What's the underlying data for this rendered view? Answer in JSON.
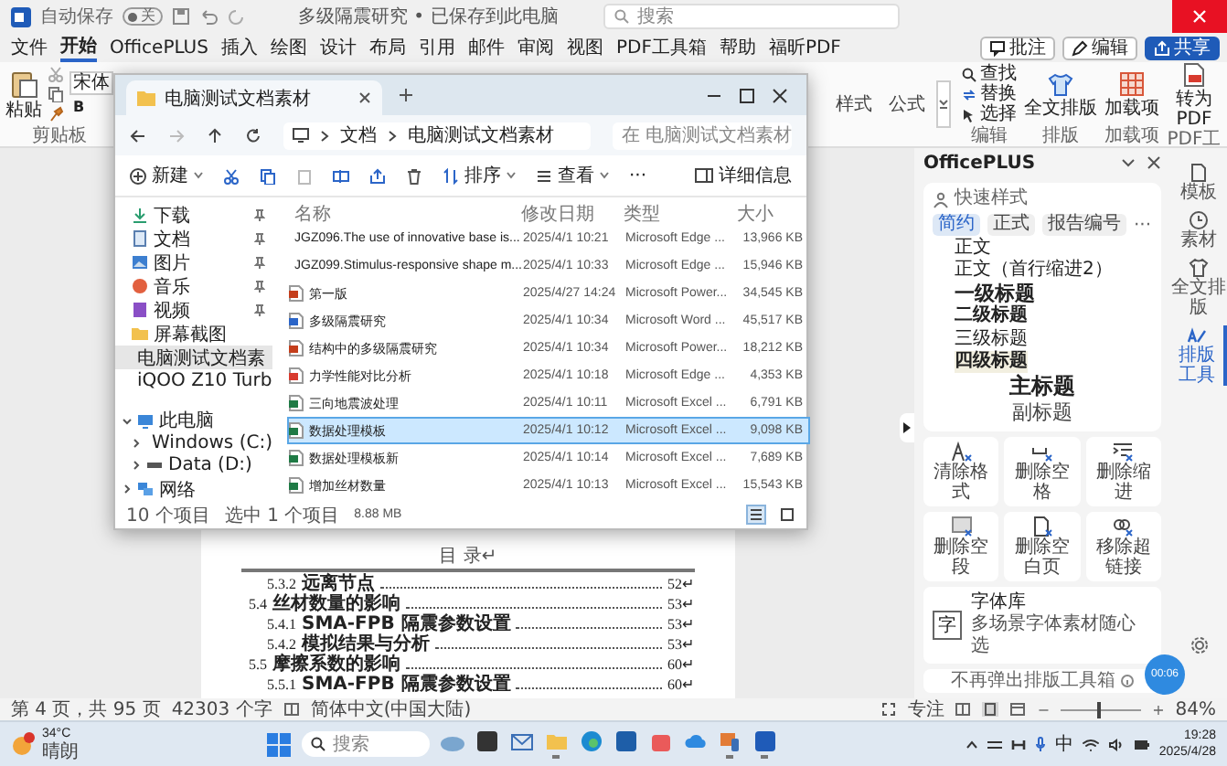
{
  "word_window": {
    "autosave_label": "自动保存",
    "autosave": {
      "on": false,
      "label": "关"
    },
    "title": "多级隔震研究 • 已保存到此电脑",
    "search_placeholder": "搜索"
  },
  "ribbon_tabs": [
    {
      "label": "文件",
      "selected": false
    },
    {
      "label": "开始",
      "selected": true
    },
    {
      "label": "OfficePLUS",
      "selected": false
    },
    {
      "label": "插入",
      "selected": false
    },
    {
      "label": "绘图",
      "selected": false
    },
    {
      "label": "设计",
      "selected": false
    },
    {
      "label": "布局",
      "selected": false
    },
    {
      "label": "引用",
      "selected": false
    },
    {
      "label": "邮件",
      "selected": false
    },
    {
      "label": "审阅",
      "selected": false
    },
    {
      "label": "视图",
      "selected": false
    },
    {
      "label": "PDF工具箱",
      "selected": false
    },
    {
      "label": "帮助",
      "selected": false
    },
    {
      "label": "福昕PDF",
      "selected": false
    }
  ],
  "ribbon_actions": [
    {
      "label": "批注",
      "kind": "comment"
    },
    {
      "label": "编辑",
      "kind": "edit"
    },
    {
      "label": "共享",
      "kind": "share"
    }
  ],
  "ribbon": {
    "paste": "粘贴",
    "clipboard_group": "剪贴板",
    "font": "宋体",
    "bold": "B",
    "styles": [
      "样式",
      "公式"
    ],
    "edit_tools": [
      {
        "label": "查找",
        "kind": "find"
      },
      {
        "label": "替换",
        "kind": "replace"
      },
      {
        "label": "选择",
        "kind": "select"
      }
    ],
    "edit_group": "编辑",
    "layout": "全文排版",
    "layout_group": "排版",
    "addins": "加载项",
    "addins_group": "加载项",
    "to_pdf": "转为PDF",
    "pdf_group": "PDF工"
  },
  "document": {
    "toc_heading": "目 录↵",
    "toc": [
      {
        "kind": "subsection",
        "number": "5.3.2",
        "title": "远离节点",
        "page": "52↵"
      },
      {
        "kind": "section",
        "number": "5.4",
        "title": "丝材数量的影响",
        "page": "53↵"
      },
      {
        "kind": "subsection",
        "number": "5.4.1",
        "title": "SMA-FPB 隔震参数设置",
        "page": "53↵"
      },
      {
        "kind": "subsection",
        "number": "5.4.2",
        "title": "模拟结果与分析",
        "page": "53↵"
      },
      {
        "kind": "section",
        "number": "5.5",
        "title": "摩擦系数的影响",
        "page": "60↵"
      },
      {
        "kind": "subsection",
        "number": "5.5.1",
        "title": "SMA-FPB 隔震参数设置",
        "page": "60↵"
      }
    ]
  },
  "explorer": {
    "tab_title": "电脑测试文档素材",
    "path": [
      "文档",
      "电脑测试文档素材"
    ],
    "search_placeholder": "在 电脑测试文档素材",
    "new": "新建",
    "sort": "排序",
    "view": "查看",
    "more": "···",
    "details": "详细信息",
    "quick_access": [
      {
        "label": "下载",
        "kind": "download",
        "pinned": true,
        "selected": false
      },
      {
        "label": "文档",
        "kind": "document",
        "pinned": true,
        "selected": false
      },
      {
        "label": "图片",
        "kind": "picture",
        "pinned": true,
        "selected": false
      },
      {
        "label": "音乐",
        "kind": "music",
        "pinned": true,
        "selected": false
      },
      {
        "label": "视频",
        "kind": "video",
        "pinned": true,
        "selected": false
      },
      {
        "label": "屏幕截图",
        "kind": "folder",
        "pinned": false,
        "selected": false
      },
      {
        "label": "电脑测试文档素",
        "kind": "folder",
        "pinned": false,
        "selected": true
      },
      {
        "label": "iQOO Z10 Turb",
        "kind": "folder",
        "pinned": false,
        "selected": false
      }
    ],
    "tree": [
      {
        "label": "此电脑",
        "kind": "pc",
        "expanded": true,
        "children": [
          {
            "label": "Windows (C:)",
            "kind": "drive",
            "expanded": false
          },
          {
            "label": "Data (D:)",
            "kind": "drive",
            "expanded": false
          }
        ]
      },
      {
        "label": "网络",
        "kind": "network",
        "expanded": false
      }
    ],
    "columns": [
      "名称",
      "修改日期",
      "类型",
      "大小"
    ],
    "rows": [
      {
        "name": "JGZ096.The use of innovative base is...",
        "date": "2025/4/1 10:21",
        "type": "Microsoft Edge ...",
        "size": "13,966 KB",
        "kind": "pdf",
        "selected": false
      },
      {
        "name": "JGZ099.Stimulus-responsive shape m...",
        "date": "2025/4/1 10:33",
        "type": "Microsoft Edge ...",
        "size": "15,946 KB",
        "kind": "pdf",
        "selected": false
      },
      {
        "name": "第一版",
        "date": "2025/4/27 14:24",
        "type": "Microsoft Power...",
        "size": "34,545 KB",
        "kind": "ppt",
        "selected": false
      },
      {
        "name": "多级隔震研究",
        "date": "2025/4/1 10:34",
        "type": "Microsoft Word ...",
        "size": "45,517 KB",
        "kind": "word",
        "selected": false
      },
      {
        "name": "结构中的多级隔震研究",
        "date": "2025/4/1 10:34",
        "type": "Microsoft Power...",
        "size": "18,212 KB",
        "kind": "ppt",
        "selected": false
      },
      {
        "name": "力学性能对比分析",
        "date": "2025/4/1 10:18",
        "type": "Microsoft Edge ...",
        "size": "4,353 KB",
        "kind": "pdf",
        "selected": false
      },
      {
        "name": "三向地震波处理",
        "date": "2025/4/1 10:11",
        "type": "Microsoft Excel ...",
        "size": "6,791 KB",
        "kind": "excel",
        "selected": false
      },
      {
        "name": "数据处理模板",
        "date": "2025/4/1 10:12",
        "type": "Microsoft Excel ...",
        "size": "9,098 KB",
        "kind": "excel",
        "selected": true
      },
      {
        "name": "数据处理模板新",
        "date": "2025/4/1 10:14",
        "type": "Microsoft Excel ...",
        "size": "7,689 KB",
        "kind": "excel",
        "selected": false
      },
      {
        "name": "增加丝材数量",
        "date": "2025/4/1 10:13",
        "type": "Microsoft Excel ...",
        "size": "15,543 KB",
        "kind": "excel",
        "selected": false
      }
    ],
    "item_count": "10 个项目",
    "selection": "选中 1 个项目",
    "selection_size": "8.88 MB",
    "views": [
      {
        "kind": "details",
        "selected": true
      },
      {
        "kind": "tiles",
        "selected": false
      }
    ]
  },
  "officeplus": {
    "title": "OfficePLUS",
    "section": "快速样式",
    "style_tabs": [
      {
        "label": "简约",
        "selected": true
      },
      {
        "label": "正式",
        "selected": false
      },
      {
        "label": "报告编号",
        "selected": false
      }
    ],
    "more": "···",
    "styles": [
      {
        "label": "正文",
        "kind": "body"
      },
      {
        "label": "正文（首行缩进2）",
        "kind": "body"
      },
      {
        "label": "一级标题",
        "kind": "h1"
      },
      {
        "label": "二级标题",
        "kind": "h2"
      },
      {
        "label": "三级标题",
        "kind": "h3"
      },
      {
        "label": "四级标题",
        "kind": "h4"
      },
      {
        "label": "主标题",
        "kind": "title"
      },
      {
        "label": "副标题",
        "kind": "subtitle"
      }
    ],
    "tools": [
      {
        "label": "清除格式",
        "kind": "clear-format"
      },
      {
        "label": "删除空格",
        "kind": "delete-space"
      },
      {
        "label": "删除缩进",
        "kind": "delete-indent"
      },
      {
        "label": "删除空段",
        "kind": "delete-paragraph"
      },
      {
        "label": "删除空白页",
        "kind": "delete-page"
      },
      {
        "label": "移除超链接",
        "kind": "remove-link"
      }
    ],
    "font_card": {
      "icon_char": "字",
      "title": "字体库",
      "subtitle": "多场景字体素材随心选"
    },
    "footer": "不再弹出排版工具箱",
    "timer": "00:06",
    "side_tabs": [
      {
        "label": "模板",
        "kind": "template",
        "selected": false
      },
      {
        "label": "素材",
        "kind": "clock",
        "selected": false
      },
      {
        "label": "全文排版",
        "kind": "shirt",
        "selected": false
      },
      {
        "label": "排版工具",
        "kind": "pen",
        "selected": true
      }
    ]
  },
  "status_bar": {
    "page": "第 4 页，共 95 页",
    "words": "42303 个字",
    "language": "简体中文(中国大陆)",
    "focus": "专注",
    "zoom_out": "−",
    "zoom_slider": {
      "level": 0.45
    },
    "zoom_in": "+",
    "zoom": "84%"
  },
  "taskbar": {
    "weather": {
      "temp": "34°C",
      "condition": "晴朗"
    },
    "search_placeholder": "搜索",
    "apps": [
      {
        "kind": "landscape",
        "running": false
      },
      {
        "kind": "terminal",
        "running": false
      },
      {
        "kind": "mail",
        "running": false
      },
      {
        "kind": "folder",
        "running": true
      },
      {
        "kind": "edge",
        "running": false
      },
      {
        "kind": "store",
        "running": false
      },
      {
        "kind": "bag",
        "running": false
      },
      {
        "kind": "cloud",
        "running": false
      },
      {
        "kind": "phone",
        "running": true
      },
      {
        "kind": "word",
        "running": true
      }
    ],
    "ime": "中",
    "time": "19:28",
    "date": "2025/4/28"
  }
}
